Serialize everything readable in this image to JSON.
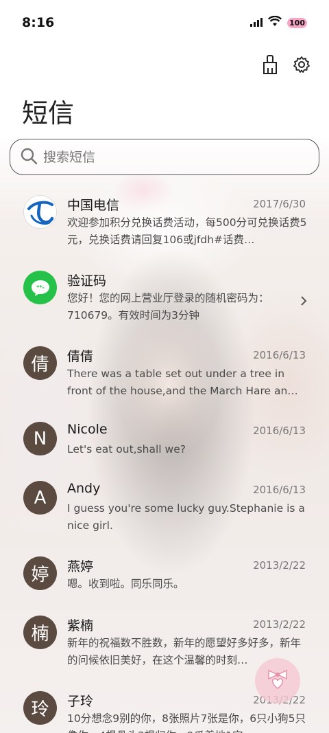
{
  "status": {
    "time": "8:16",
    "battery": "100"
  },
  "header": {
    "title": "短信"
  },
  "toolbar": {
    "clean_icon": "broom-icon",
    "settings_icon": "gear-icon"
  },
  "search": {
    "placeholder": "搜索短信"
  },
  "messages": [
    {
      "name": "中国电信",
      "date": "2017/6/30",
      "preview": "欢迎参加积分兑换话费活动，每500分可兑换话费5元，兑换话费请回复106或jfdh#话费…",
      "avatar": "",
      "avatar_type": "telecom-logo"
    },
    {
      "name": "验证码",
      "date": "",
      "preview": "您好！您的网上营业厅登录的随机密码为：710679。有效时间为3分钟",
      "avatar": "",
      "avatar_type": "message-bubble"
    },
    {
      "name": "倩倩",
      "date": "2016/6/13",
      "preview": "There was a table set out under a tree in front of the house,and the March Hare an…",
      "avatar": "倩"
    },
    {
      "name": "Nicole",
      "date": "2016/6/13",
      "preview": "Let's eat out,shall we?",
      "avatar": "N"
    },
    {
      "name": "Andy",
      "date": "2016/6/13",
      "preview": "I guess you're some lucky guy.Stephanie is a nice girl.",
      "avatar": "A"
    },
    {
      "name": "燕婷",
      "date": "2013/2/22",
      "preview": "嗯。收到啦。同乐同乐。",
      "avatar": "婷"
    },
    {
      "name": "紫楠",
      "date": "2013/2/22",
      "preview": "新年的祝福数不胜数，新年的愿望好多好多，新年的问候依旧美好，在这个温馨的时刻…",
      "avatar": "楠"
    },
    {
      "name": "子玲",
      "date": "2013/2/22",
      "preview": "10分想念9别的你，8张照片7张是你，6只小狗5只像你，4根骨头3根归你，2爪着地1定",
      "avatar": "玲"
    }
  ],
  "fab": {
    "icon": "bow-heart-icon"
  },
  "colors": {
    "avatar_bg": "#5b4a40",
    "accent_green": "#25c148",
    "telecom_blue": "#1565c0"
  }
}
